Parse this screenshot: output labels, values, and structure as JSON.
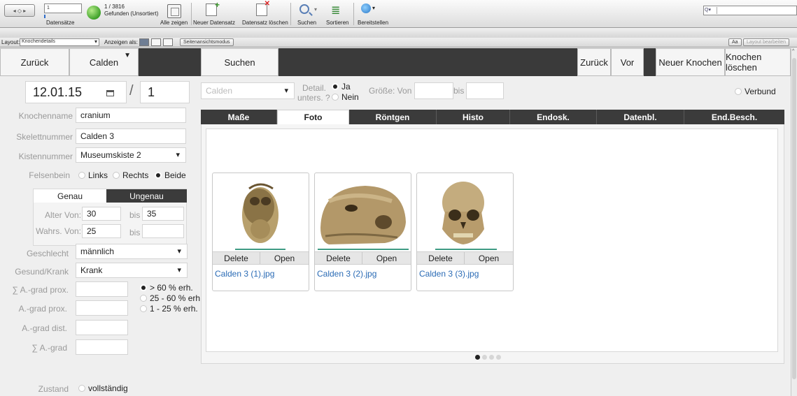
{
  "toolbar": {
    "record_field": "1",
    "records_label": "Datensätze",
    "found_count": "1 / 3816",
    "found_status": "Gefunden (Unsortiert)",
    "show_all": "Alle zeigen",
    "new_record": "Neuer Datensatz",
    "delete_record": "Datensatz löschen",
    "search": "Suchen",
    "sort": "Sortieren",
    "share": "Bereitstellen"
  },
  "layoutbar": {
    "layout_label": "Layout:",
    "layout_value": "Knochendetails",
    "view_as": "Anzeigen als:",
    "preview_mode": "Seitenansichtsmodus",
    "aa": "Aa",
    "edit_layout": "Layout bearbeiten"
  },
  "nav": {
    "back": "Zurück",
    "location": "Calden",
    "search": "Suchen",
    "back2": "Zurück",
    "forward": "Vor",
    "new_bone": "Neuer Knochen",
    "delete_bone": "Knochen löschen"
  },
  "header": {
    "date": "12.01.15",
    "slash": "/",
    "number": "1",
    "site_select": "Calden",
    "detail_label_1": "Detail.",
    "detail_label_2": "unters. ?",
    "detail_yes": "Ja",
    "detail_no": "Nein",
    "size_from": "Größe: Von",
    "size_to": "bis",
    "verbund": "Verbund"
  },
  "form": {
    "bone_name_label": "Knochenname",
    "bone_name": "cranium",
    "skeleton_label": "Skelettnummer",
    "skeleton": "Calden 3",
    "box_label": "Kistennummer",
    "box": "Museumskiste 2",
    "petrous_label": "Felsenbein",
    "petrous_options": [
      "Links",
      "Rechts",
      "Beide"
    ],
    "precision_tabs": [
      "Genau",
      "Ungenau"
    ],
    "age_from_label": "Alter Von:",
    "age_from": "30",
    "age_to_label": "bis",
    "age_to": "35",
    "prob_from_label": "Wahrs. Von:",
    "prob_from": "25",
    "prob_to_label": "bis",
    "sex_label": "Geschlecht",
    "sex": "männlich",
    "health_label": "Gesund/Krank",
    "health": "Krank",
    "sum_prox_label": "∑ A.-grad prox.",
    "prox_label": "A.-grad prox.",
    "dist_label": "A.-grad dist.",
    "sum_label": "∑ A.-grad",
    "preservation_options": [
      "> 60 % erh.",
      "25 - 60 % erh.",
      "1 - 25 % erh."
    ],
    "condition_label": "Zustand",
    "condition_option": "vollständig"
  },
  "tabs": [
    "Maße",
    "Foto",
    "Röntgen",
    "Histo",
    "Endosk.",
    "Datenbl.",
    "End.Besch."
  ],
  "photos": [
    {
      "delete": "Delete",
      "open": "Open",
      "file": "Calden 3 (1).jpg"
    },
    {
      "delete": "Delete",
      "open": "Open",
      "file": "Calden 3 (2).jpg"
    },
    {
      "delete": "Delete",
      "open": "Open",
      "file": "Calden 3 (3).jpg"
    }
  ],
  "colors": {
    "dark_bar": "#3a3a3a",
    "link": "#2a6bb5",
    "accent_green": "#3f9b84"
  }
}
